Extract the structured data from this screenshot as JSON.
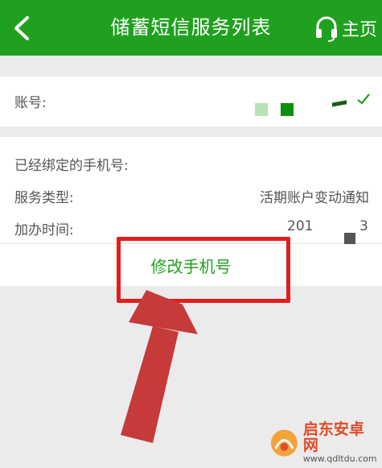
{
  "header": {
    "title": "储蓄短信服务列表",
    "home_label": "主页",
    "back_icon": "chevron-left-icon",
    "headset_icon": "headset-icon",
    "bg_color": "#1fa11f"
  },
  "account": {
    "label": "账号:"
  },
  "details": {
    "bound_phone_label": "已经绑定的手机号:",
    "service_type_label": "服务类型:",
    "service_type_value": "活期账户变动通知",
    "added_time_label": "加办时间:",
    "added_time_value_part1": "201",
    "added_time_value_part2": "3",
    "modify_phone_label": "修改手机号"
  },
  "watermark": {
    "line1": "启东安卓网",
    "line2": "www.qdltdu.com"
  },
  "colors": {
    "accent": "#1fa11f",
    "annotation_red": "#e11d1d",
    "arrow_red": "#c63a3a"
  }
}
